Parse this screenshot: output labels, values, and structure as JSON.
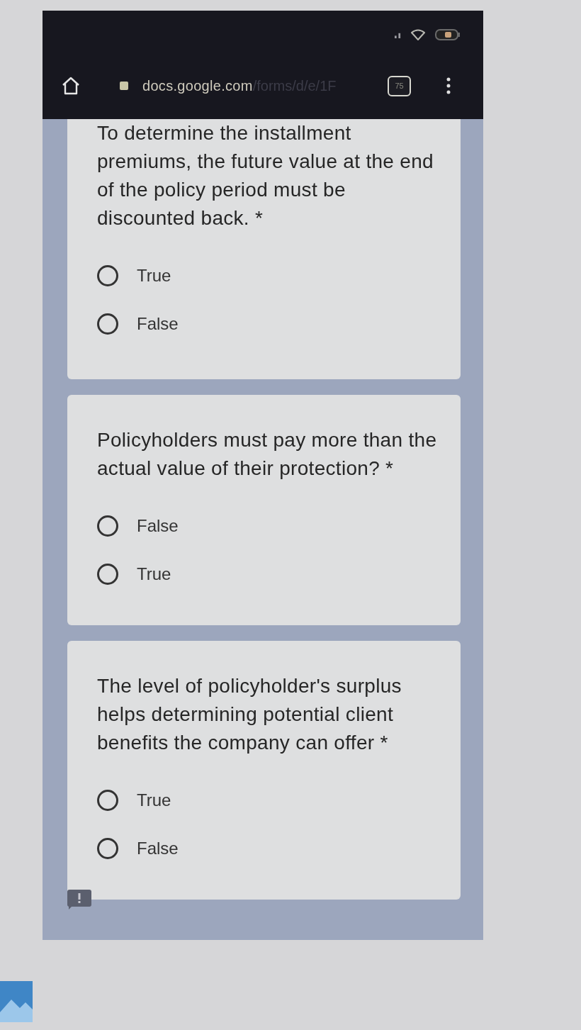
{
  "browser": {
    "url_host": "docs.google.com",
    "url_path": "/forms/d/e/1F",
    "tab_count": "75"
  },
  "questions": [
    {
      "title": "To determine the installment premiums, the future value at the end of the policy period must be discounted back. *",
      "options": [
        {
          "label": "True",
          "selected": false
        },
        {
          "label": "False",
          "selected": false
        }
      ]
    },
    {
      "title": "Policyholders must pay more than the actual value of their protection? *",
      "options": [
        {
          "label": "False",
          "selected": false
        },
        {
          "label": "True",
          "selected": false
        }
      ]
    },
    {
      "title": "The level of policyholder's surplus helps determining potential client benefits the company can offer *",
      "options": [
        {
          "label": "True",
          "selected": false
        },
        {
          "label": "False",
          "selected": false
        }
      ]
    }
  ]
}
